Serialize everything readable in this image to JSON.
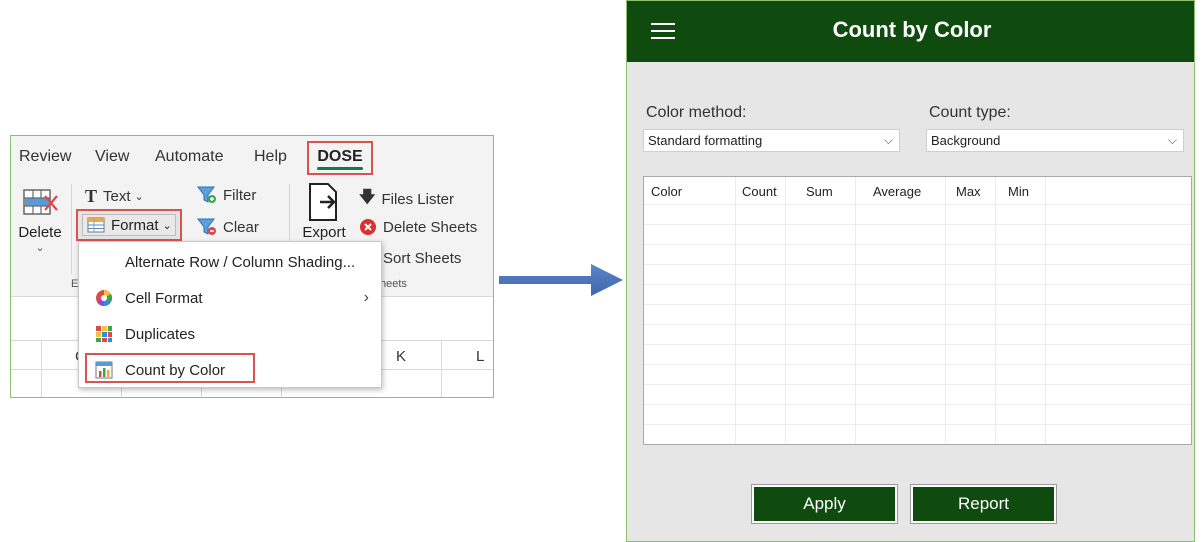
{
  "ribbon": {
    "tabs": [
      "Review",
      "View",
      "Automate",
      "Help"
    ],
    "active_tab": "DOSE",
    "delete_label": "Delete",
    "export_label": "Export",
    "text_label": "Text",
    "format_label": "Format",
    "filter_label": "Filter",
    "clear_label": "Clear",
    "files_lister_label": "Files Lister",
    "delete_sheets_label": "Delete Sheets",
    "sort_sheets_label": "Sort Sheets",
    "group_label_left": "E",
    "group_label_right": "heets",
    "columns": [
      "C",
      "K",
      "L"
    ]
  },
  "format_menu": {
    "items": [
      {
        "label": "Alternate Row / Column Shading...",
        "icon": "none"
      },
      {
        "label": "Cell Format",
        "icon": "color-wheel-icon",
        "submenu": true
      },
      {
        "label": "Duplicates",
        "icon": "duplicates-grid-icon"
      },
      {
        "label": "Count by Color",
        "icon": "count-by-color-icon"
      }
    ]
  },
  "panel": {
    "title": "Count by Color",
    "color_method": {
      "label": "Color method:",
      "value": "Standard formatting"
    },
    "count_type": {
      "label": "Count type:",
      "value": "Background"
    },
    "columns": [
      "Color",
      "Count",
      "Sum",
      "Average",
      "Max",
      "Min"
    ],
    "apply_label": "Apply",
    "report_label": "Report"
  },
  "colors": {
    "accent_dark_green": "#0f4a0f",
    "excel_green": "#107c41",
    "highlight_red": "#d9534f",
    "arrow_blue": "#4472c4"
  }
}
